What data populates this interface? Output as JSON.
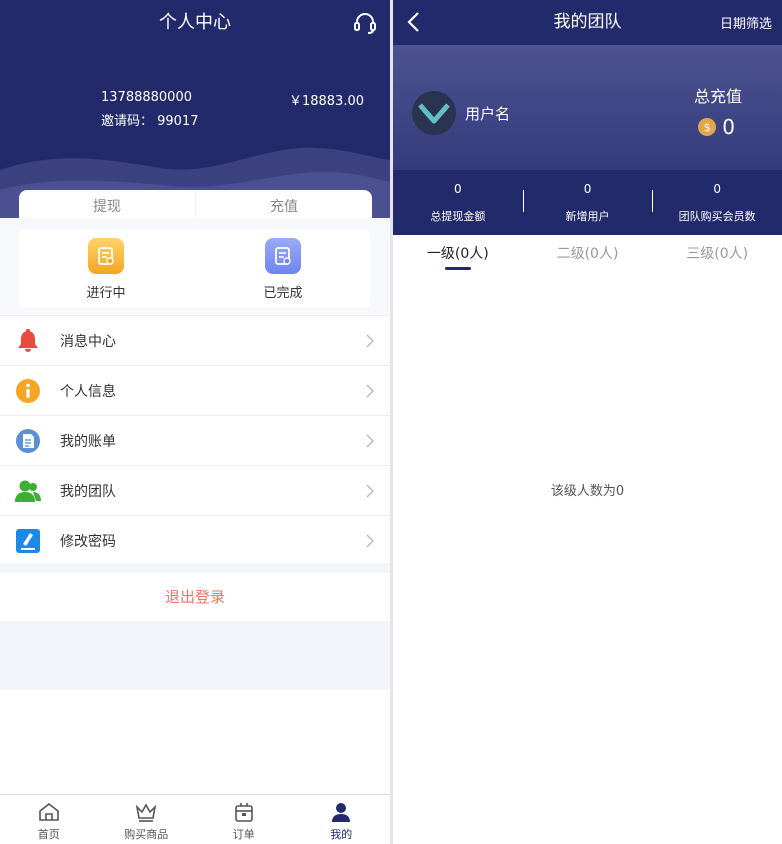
{
  "left": {
    "title": "个人中心",
    "icons": {
      "support": "headset-icon"
    },
    "account": {
      "phone": "13788880000",
      "invite": "邀请码：  99017",
      "balance": "￥18883.00"
    },
    "tabs": [
      {
        "label": "提现"
      },
      {
        "label": "充值"
      }
    ],
    "status": [
      {
        "label": "进行中",
        "icon": "clipboard-icon",
        "color": "#f9a825"
      },
      {
        "label": "已完成",
        "icon": "clipboard-check-icon",
        "color": "#6f84f0"
      }
    ],
    "menu": [
      {
        "label": "消息中心",
        "icon": "bell-icon",
        "color": "#e94b3c"
      },
      {
        "label": "个人信息",
        "icon": "info-icon",
        "color": "#f5a623"
      },
      {
        "label": "我的账单",
        "icon": "bill-icon",
        "color": "#5b8fd6"
      },
      {
        "label": "我的团队",
        "icon": "team-icon",
        "color": "#3cb034"
      },
      {
        "label": "修改密码",
        "icon": "edit-icon",
        "color": "#1e88e5"
      }
    ],
    "logout": "退出登录",
    "nav": [
      {
        "label": "首页",
        "icon": "home-icon"
      },
      {
        "label": "购买商品",
        "icon": "crown-icon"
      },
      {
        "label": "订单",
        "icon": "bag-icon"
      },
      {
        "label": "我的",
        "icon": "user-icon"
      }
    ],
    "active_nav": "我的"
  },
  "right": {
    "title": "我的团队",
    "filter": "日期筛选",
    "username": "用户名",
    "total_label": "总充值",
    "total_value": "0",
    "coin_symbol": "$",
    "stats": [
      {
        "value": "0",
        "label": "总提现金额"
      },
      {
        "value": "0",
        "label": "新增用户"
      },
      {
        "value": "0",
        "label": "团队购买会员数"
      }
    ],
    "levels": [
      {
        "label": "一级(0人)"
      },
      {
        "label": "二级(0人)"
      },
      {
        "label": "三级(0人)"
      }
    ],
    "active_level": "一级(0人)",
    "empty_text": "该级人数为0"
  },
  "colors": {
    "primary": "#232a6b",
    "accent": "#e9785b",
    "coin": "#e2a64d"
  }
}
